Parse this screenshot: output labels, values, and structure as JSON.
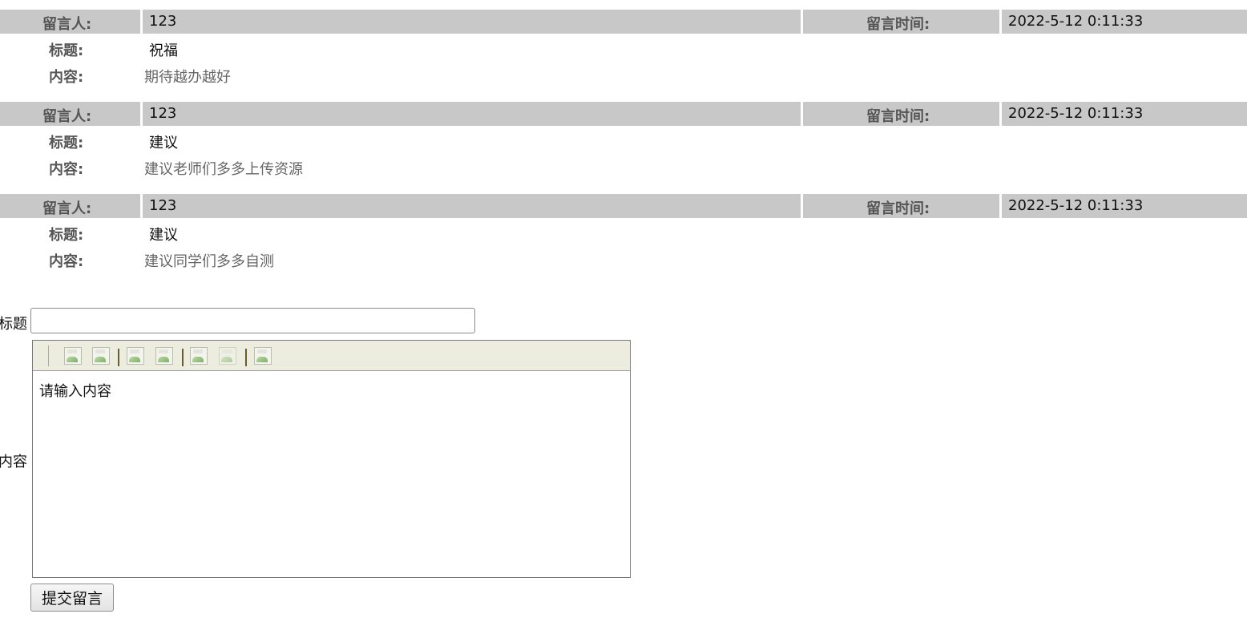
{
  "labels": {
    "author": "留言人:",
    "time": "留言时间:",
    "title": "标题:",
    "content": "内容:"
  },
  "messages": [
    {
      "author": "123",
      "time": "2022-5-12 0:11:33",
      "title": "祝福",
      "content": "期待越办越好"
    },
    {
      "author": "123",
      "time": "2022-5-12 0:11:33",
      "title": "建议",
      "content": "建议老师们多多上传资源"
    },
    {
      "author": "123",
      "time": "2022-5-12 0:11:33",
      "title": "建议",
      "content": "建议同学们多多自测"
    }
  ],
  "form": {
    "title_label": "标题",
    "title_value": "",
    "content_label": "内容",
    "content_value": "请输入内容",
    "submit_label": "提交留言"
  },
  "toolbar": {
    "icons": [
      "image-icon",
      "image-icon",
      "image-icon",
      "image-icon",
      "image-icon",
      "image-icon",
      "image-icon"
    ]
  }
}
